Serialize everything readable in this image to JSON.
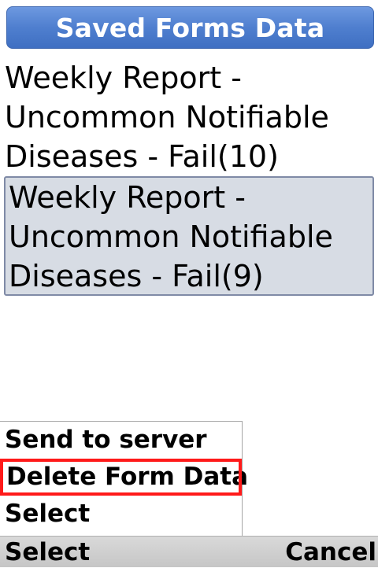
{
  "header": {
    "title": "Saved Forms Data"
  },
  "forms": [
    {
      "lines": [
        "Weekly Report -",
        "Uncommon Notifiable",
        "Diseases - Fail(10)"
      ],
      "selected": false
    },
    {
      "lines": [
        "Weekly Report -",
        "Uncommon Notifiable",
        "Diseases - Fail(9)"
      ],
      "selected": true
    }
  ],
  "menu": {
    "items": [
      {
        "label": "Send to server"
      },
      {
        "label": "Delete Form Data",
        "highlighted": true
      },
      {
        "label": "Select"
      }
    ]
  },
  "softkeys": {
    "left": "Select",
    "right": "Cancel"
  },
  "colors": {
    "title_bar": "#4f7fcf",
    "selected_item_bg": "#d7dce4",
    "highlight_outline": "#ff1a1a",
    "softkey_bar": "#cfcfcf"
  }
}
